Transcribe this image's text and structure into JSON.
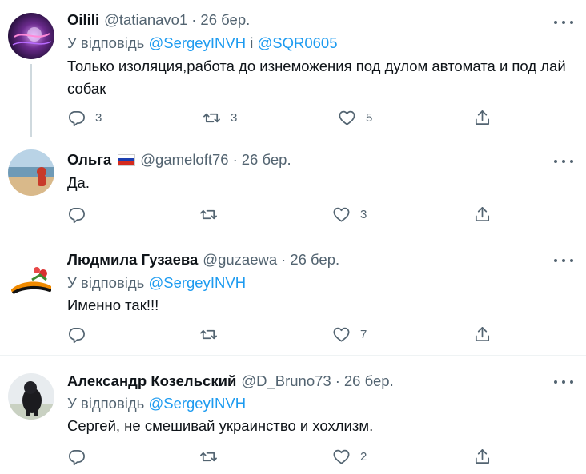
{
  "reply_prefix": "У відповідь",
  "reply_joiner": "і",
  "tweets": [
    {
      "name": "Oilili",
      "handle": "@tatianavo1",
      "date": "26 бер.",
      "reply_to": [
        "@SergeyINVH",
        "@SQR0605"
      ],
      "text": "Только изоляция,работа до изнеможения под дулом автомата и под лай собак",
      "stats": {
        "replies": "3",
        "retweets": "3",
        "likes": "5"
      }
    },
    {
      "name": "Ольга",
      "handle": "@gameloft76",
      "date": "26 бер.",
      "text": "Да.",
      "stats": {
        "replies": "",
        "retweets": "",
        "likes": "3"
      }
    },
    {
      "name": "Людмила Гузаева",
      "handle": "@guzaewa",
      "date": "26 бер.",
      "reply_to": [
        "@SergeyINVH"
      ],
      "text": "Именно так!!!",
      "stats": {
        "replies": "",
        "retweets": "",
        "likes": "7"
      }
    },
    {
      "name": "Александр Козельский",
      "handle": "@D_Bruno73",
      "date": "26 бер.",
      "reply_to": [
        "@SergeyINVH"
      ],
      "text": "Сергей, не смешивай украинство и хохлизм.",
      "stats": {
        "replies": "",
        "retweets": "",
        "likes": "2"
      }
    }
  ],
  "colors": {
    "text": "#0f1419",
    "secondary": "#536471",
    "link": "#1d9bf0",
    "divider": "#eff3f4",
    "thread_line": "#cfd9de"
  },
  "icons": [
    "reply-icon",
    "retweet-icon",
    "like-icon",
    "share-icon",
    "more-icon",
    "russian-flag-icon"
  ]
}
